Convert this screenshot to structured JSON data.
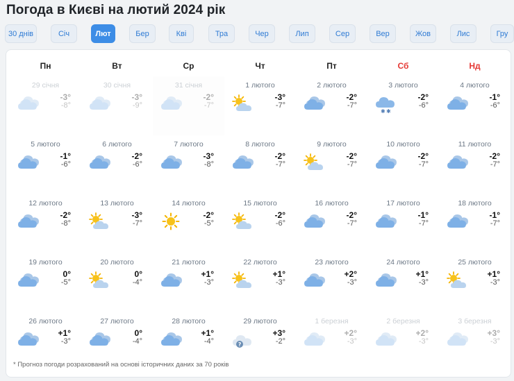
{
  "page": {
    "title": "Погода в Києві на лютий 2024 рік",
    "footnote": "* Прогноз погоди розрахований на основі історичних даних за 70 років"
  },
  "months": [
    {
      "label": "30 днів",
      "active": false
    },
    {
      "label": "Січ",
      "active": false
    },
    {
      "label": "Лют",
      "active": true
    },
    {
      "label": "Бер",
      "active": false
    },
    {
      "label": "Кві",
      "active": false
    },
    {
      "label": "Тра",
      "active": false
    },
    {
      "label": "Чер",
      "active": false
    },
    {
      "label": "Лип",
      "active": false
    },
    {
      "label": "Сер",
      "active": false
    },
    {
      "label": "Вер",
      "active": false
    },
    {
      "label": "Жов",
      "active": false
    },
    {
      "label": "Лис",
      "active": false
    },
    {
      "label": "Гру",
      "active": false
    }
  ],
  "weekdays": [
    {
      "label": "Пн",
      "weekend": false
    },
    {
      "label": "Вт",
      "weekend": false
    },
    {
      "label": "Ср",
      "weekend": false
    },
    {
      "label": "Чт",
      "weekend": false
    },
    {
      "label": "Пт",
      "weekend": false
    },
    {
      "label": "Сб",
      "weekend": true
    },
    {
      "label": "Нд",
      "weekend": true
    }
  ],
  "days": [
    {
      "date": "29 січня",
      "max": "-3°",
      "min": "-8°",
      "icon": "cloudy-icon",
      "out": true
    },
    {
      "date": "30 січня",
      "max": "-3°",
      "min": "-9°",
      "icon": "cloudy-icon",
      "out": true
    },
    {
      "date": "31 січня",
      "max": "-2°",
      "min": "-7°",
      "icon": "cloudy-icon",
      "out": true
    },
    {
      "date": "1 лютого",
      "max": "-3°",
      "min": "-7°",
      "icon": "partly-sunny-icon",
      "out": false
    },
    {
      "date": "2 лютого",
      "max": "-2°",
      "min": "-7°",
      "icon": "cloudy-icon",
      "out": false
    },
    {
      "date": "3 лютого",
      "max": "-2°",
      "min": "-6°",
      "icon": "snow-icon",
      "out": false
    },
    {
      "date": "4 лютого",
      "max": "-1°",
      "min": "-6°",
      "icon": "cloudy-icon",
      "out": false
    },
    {
      "date": "5 лютого",
      "max": "-1°",
      "min": "-6°",
      "icon": "cloudy-icon",
      "out": false
    },
    {
      "date": "6 лютого",
      "max": "-2°",
      "min": "-6°",
      "icon": "cloudy-icon",
      "out": false
    },
    {
      "date": "7 лютого",
      "max": "-3°",
      "min": "-8°",
      "icon": "cloudy-icon",
      "out": false
    },
    {
      "date": "8 лютого",
      "max": "-2°",
      "min": "-7°",
      "icon": "cloudy-icon",
      "out": false
    },
    {
      "date": "9 лютого",
      "max": "-2°",
      "min": "-7°",
      "icon": "partly-sunny-icon",
      "out": false
    },
    {
      "date": "10 лютого",
      "max": "-2°",
      "min": "-7°",
      "icon": "cloudy-icon",
      "out": false
    },
    {
      "date": "11 лютого",
      "max": "-2°",
      "min": "-7°",
      "icon": "cloudy-icon",
      "out": false
    },
    {
      "date": "12 лютого",
      "max": "-2°",
      "min": "-8°",
      "icon": "cloudy-icon",
      "out": false
    },
    {
      "date": "13 лютого",
      "max": "-3°",
      "min": "-7°",
      "icon": "partly-sunny-icon",
      "out": false
    },
    {
      "date": "14 лютого",
      "max": "-2°",
      "min": "-5°",
      "icon": "sun-icon",
      "out": false
    },
    {
      "date": "15 лютого",
      "max": "-2°",
      "min": "-6°",
      "icon": "partly-sunny-icon",
      "out": false
    },
    {
      "date": "16 лютого",
      "max": "-2°",
      "min": "-7°",
      "icon": "cloudy-icon",
      "out": false
    },
    {
      "date": "17 лютого",
      "max": "-1°",
      "min": "-7°",
      "icon": "cloudy-icon",
      "out": false
    },
    {
      "date": "18 лютого",
      "max": "-1°",
      "min": "-7°",
      "icon": "cloudy-icon",
      "out": false
    },
    {
      "date": "19 лютого",
      "max": "0°",
      "min": "-5°",
      "icon": "cloudy-icon",
      "out": false
    },
    {
      "date": "20 лютого",
      "max": "0°",
      "min": "-4°",
      "icon": "partly-sunny-icon",
      "out": false
    },
    {
      "date": "21 лютого",
      "max": "+1°",
      "min": "-3°",
      "icon": "cloudy-icon",
      "out": false
    },
    {
      "date": "22 лютого",
      "max": "+1°",
      "min": "-3°",
      "icon": "partly-sunny-icon",
      "out": false
    },
    {
      "date": "23 лютого",
      "max": "+2°",
      "min": "-3°",
      "icon": "cloudy-icon",
      "out": false
    },
    {
      "date": "24 лютого",
      "max": "+1°",
      "min": "-3°",
      "icon": "cloudy-icon",
      "out": false
    },
    {
      "date": "25 лютого",
      "max": "+1°",
      "min": "-3°",
      "icon": "partly-sunny-icon",
      "out": false
    },
    {
      "date": "26 лютого",
      "max": "+1°",
      "min": "-3°",
      "icon": "cloudy-icon",
      "out": false
    },
    {
      "date": "27 лютого",
      "max": "0°",
      "min": "-4°",
      "icon": "cloudy-icon",
      "out": false
    },
    {
      "date": "28 лютого",
      "max": "+1°",
      "min": "-4°",
      "icon": "cloudy-icon",
      "out": false
    },
    {
      "date": "29 лютого",
      "max": "+3°",
      "min": "-2°",
      "icon": "unknown-weather-icon",
      "out": false
    },
    {
      "date": "1 березня",
      "max": "+2°",
      "min": "-3°",
      "icon": "cloudy-icon",
      "out": true
    },
    {
      "date": "2 березня",
      "max": "+2°",
      "min": "-3°",
      "icon": "cloudy-icon",
      "out": true
    },
    {
      "date": "3 березня",
      "max": "+3°",
      "min": "-3°",
      "icon": "cloudy-icon",
      "out": true
    }
  ]
}
